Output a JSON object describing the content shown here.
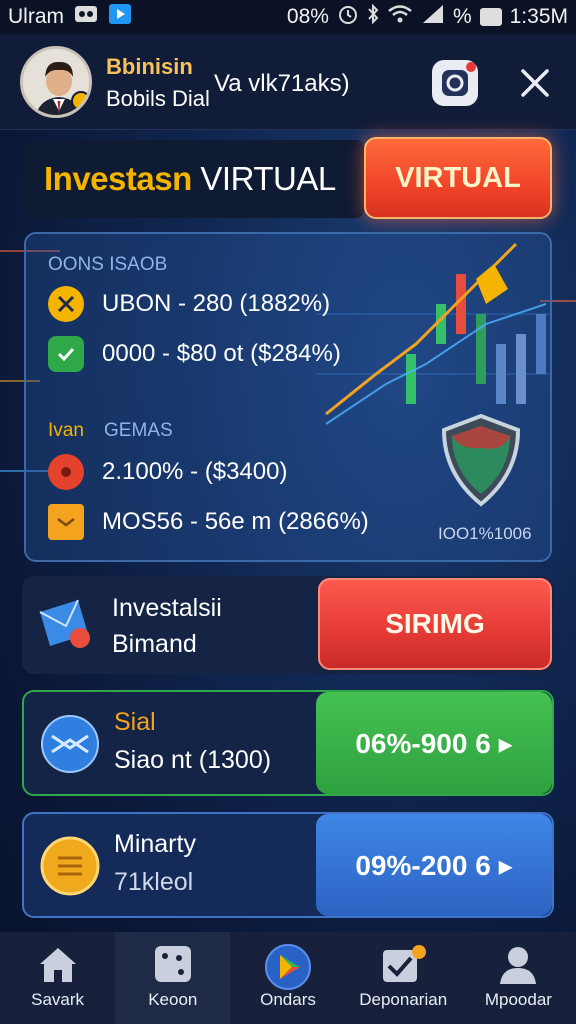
{
  "status_bar": {
    "carrier": "Ulram",
    "battery": "08%",
    "percent_sign": "%",
    "time": "1:35M"
  },
  "header": {
    "title": "Bbinisin",
    "subtitle": "Bobils  Dial",
    "middle_text": "Va vlk71aks)",
    "camera_icon": "camera-icon",
    "close_icon": "close-icon"
  },
  "title_bar": {
    "title_part1": "Investasn",
    "title_part2": "Virtual",
    "button_label": "VIRTUAL"
  },
  "panel": {
    "section1_label": "OONS ISAOB",
    "rows1": [
      {
        "icon": "antenna-icon",
        "text": "UBON - 280 (1882%)"
      },
      {
        "icon": "check-shield-icon",
        "text": "0000 - $80 ot ($284%)"
      }
    ],
    "section2_label_a": "Ivan",
    "section2_label_b": "GEMAS",
    "rows2": [
      {
        "icon": "gear-icon",
        "text": "2.100% - ($3400)"
      },
      {
        "icon": "box-icon",
        "text": "MOS56 - 56e m (2866%)"
      }
    ],
    "footer": "IOO1%1006",
    "accent_orange": "#f4a31f",
    "accent_red": "#e5422e",
    "accent_green": "#2fa84a",
    "accent_blue": "#2c63c2"
  },
  "cards": [
    {
      "title": "Investalsii",
      "subtitle": "Bimand",
      "action": "SIRIMG",
      "icon": "envelope-icon"
    },
    {
      "title": "Sial",
      "subtitle": "Siao nt (1300)",
      "action": "06%-900 6 ▸",
      "icon": "blue-emblem-icon"
    },
    {
      "title": "Minarty",
      "subtitle": "71kleol",
      "action": "09%-200 6 ▸",
      "icon": "gold-coin-icon"
    }
  ],
  "nav": [
    {
      "label": "Savark",
      "icon": "home-icon"
    },
    {
      "label": "Keoon",
      "icon": "dice-icon"
    },
    {
      "label": "Ondars",
      "icon": "play-store-icon"
    },
    {
      "label": "Deponarian",
      "icon": "checklist-icon"
    },
    {
      "label": "Mpoodar",
      "icon": "profile-icon"
    }
  ]
}
